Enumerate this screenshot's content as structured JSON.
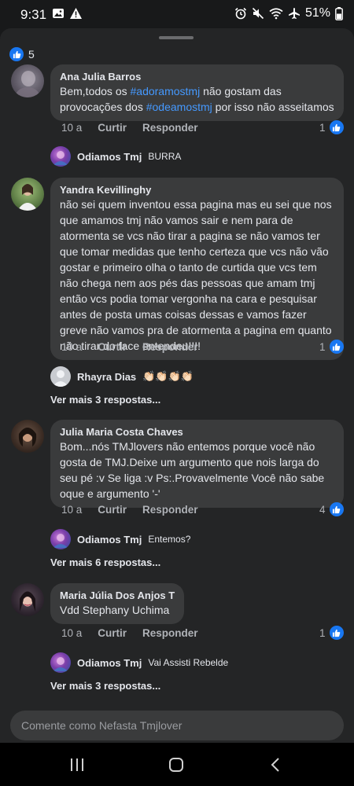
{
  "status_bar": {
    "time": "9:31",
    "battery": "51%"
  },
  "post_reactions": {
    "count": "5",
    "icon": "thumbs-up-icon"
  },
  "comments": [
    {
      "author": "Ana Julia Barros",
      "text_parts": [
        "Bem,todos os ",
        "#adoramostmj",
        "  não gostam das provocações dos ",
        "#odeamostmj",
        " por isso não asseitamos"
      ],
      "time": "10 a",
      "like_label": "Curtir",
      "reply_label": "Responder",
      "likes": "1",
      "reply": {
        "author": "Odiamos Tmj",
        "text": "BURRA"
      }
    },
    {
      "author": "Yandra Kevillinghy",
      "text": "não sei quem inventou essa pagina mas eu sei que nos que amamos tmj não vamos sair e nem para de atormenta se vcs não tirar  a pagina se não vamos ter que tomar medidas que tenho certeza que vcs não vão gostar e primeiro olha o tanto de curtida que vcs tem não chega nem aos pés das pessoas que amam tmj então vcs podia tomar vergonha na cara  e pesquisar antes de posta umas coisas dessas e vamos fazer greve não vamos pra de atormenta a pagina em quanto não tirar do face entendeu!!!!",
      "time": "10 a",
      "like_label": "Curtir",
      "reply_label": "Responder",
      "likes": "1",
      "reply": {
        "author": "Rhayra Dias",
        "text": "👏🏻👏🏻👏🏻👏🏻"
      },
      "more_replies": "Ver mais 3 respostas..."
    },
    {
      "author": "Julia Maria Costa Chaves",
      "text": "Bom...nós TMJlovers não entemos porque você não gosta de TMJ.Deixe um argumento que nois larga do seu pé :v Se liga :v Ps:.Provavelmente Você não sabe oque e argumento '-'",
      "time": "10 a",
      "like_label": "Curtir",
      "reply_label": "Responder",
      "likes": "4",
      "reply": {
        "author": "Odiamos Tmj",
        "text": "Entemos?"
      },
      "more_replies": "Ver mais 6 respostas..."
    },
    {
      "author": "Maria Júlia Dos Anjos T",
      "text": "Vdd Stephany Uchima",
      "time": "10 a",
      "like_label": "Curtir",
      "reply_label": "Responder",
      "likes": "1",
      "reply": {
        "author": "Odiamos Tmj",
        "text": "Vai Assisti Rebelde"
      },
      "more_replies": "Ver mais 3 respostas..."
    }
  ],
  "composer": {
    "placeholder": "Comente como Nefasta Tmjlover"
  },
  "colors": {
    "background": "#18191a",
    "sheet": "#242526",
    "bubble": "#3a3b3c",
    "accent": "#1877f2",
    "hashtag": "#4599ff"
  }
}
